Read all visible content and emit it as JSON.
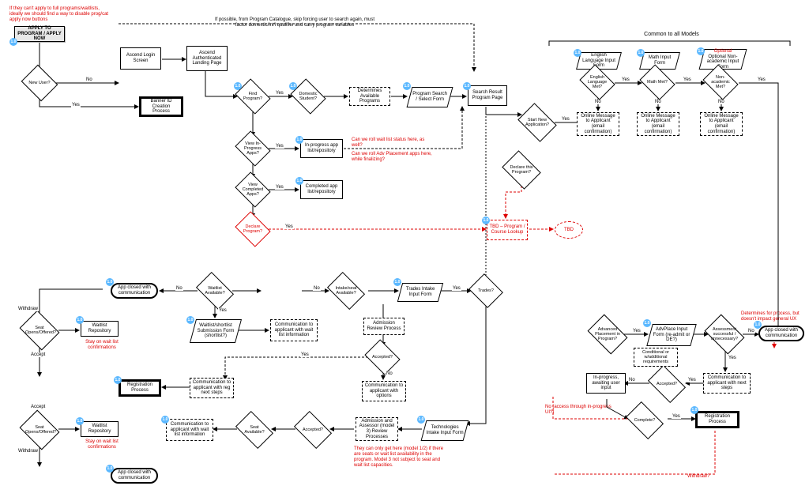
{
  "notes": {
    "top_left": "If they can't apply to full programs/waitlists, ideally we should find a way to disable prog/cat apply now buttons",
    "top_mid": "If possible, from Program Catalogue, skip forcing user to search again, must factor domestic/int'l qualifier and carry program variables",
    "common": "Common to all Models",
    "inprog_q1": "Can we roll wait list status here, as well?",
    "inprog_q2": "Can we roll Adv Placement apps here, while finalizing?",
    "stay1": "Stay on wait list confirmations",
    "stay2": "Stay on wait list confirmations",
    "model_note": "They can only get here (model 1/2) if there are seats or wait list availability in the program. Model 3 not subject to seat and wait list capacities.",
    "no_access": "No (access through in-progress UI?)",
    "withdraw_q": "Withdraw?",
    "det_process": "Determines for process, but doesn't impact general UX"
  },
  "start": "APPLY TO PROGRAM / APPLY NOW",
  "nodes": {
    "new_user": "New User?",
    "ascend_login": "Ascend Login Screen",
    "ascend_landing": "Ascend Authenticated Landing Page",
    "banner_id": "Banner ID Creation Process",
    "find_program": "Find Program?",
    "domestic": "Domestic Student?",
    "det_programs": "Determines Available Programs",
    "search_form": "Program Search / Select Form",
    "search_result": "Search Result Program Page",
    "view_inprog": "View In-Progress Apps?",
    "inprog_list": "In-progress app list/repository",
    "view_complete": "View Completed Apps?",
    "complete_list": "Completed app list/repository",
    "declare": "Declare Program?",
    "tbd_lookup": "TBD – Program / Course Lookup",
    "tbd": "TBD",
    "start_new": "Start New Application?",
    "eng_form": "English Language Input Form",
    "eng_met": "English Language Met?",
    "math_form": "Math Input Form",
    "math_met": "Math Met?",
    "nonacad_form": "Optional Non-academic Input Form",
    "nonacad_met": "Non-academic Met?",
    "msg_eng": "Online Message to Applicant (email confirmation)",
    "msg_math": "Online Message to Applicant (email confirmation)",
    "msg_nonacad": "Online Message to Applicant (email confirmation)",
    "declare_this": "Declare this Program?",
    "advplace": "Advanced Placement in Program?",
    "advplace_form": "AdvPlace Input Form (re-admit or DE?)",
    "assess": "Assessment successful / unnecessary?",
    "app_closed_r": "App closed with communication",
    "inprog_wait": "In-progress, awaiting user input",
    "cond_req": "Conditional or w/additional requirements",
    "accepted_r": "Accepted?",
    "comm_next_r": "Communication to applicant with next steps",
    "complete_q": "Complete?",
    "reg_process_r": "Registration Process",
    "trades_q": "Trades?",
    "trades_form": "Trades Intake Input Form",
    "intake_avail": "Intake/seat Available?",
    "waitlist_avail": "Waitlist Available?",
    "app_closed_l1": "App closed with communication",
    "waitlist_form": "Waitlist/shortlist Submission Form (shortlist?)",
    "comm_wait": "Communication to applicant with wait list information",
    "adm_review": "Admission Review Process",
    "accepted_m": "Accepted?",
    "comm_options": "Communication to applicant with options",
    "tech_form": "Technologies Intake Input Form",
    "adm_assessor": "Admission and Assessor (model 3) Review Processes",
    "accepted_b": "Accepted?",
    "seat_avail": "Seat Available?",
    "comm_wait2": "Communication to applicant with wait list information",
    "waitlist_repo1": "Waitlist Repository",
    "waitlist_repo2": "Waitlist Repository",
    "seat_open1": "Seat Opens/Offered?",
    "seat_open2": "Seat Opens/Offered?",
    "reg_process_l": "Registration Process",
    "comm_reg_next": "Communication to applicant with reg next steps",
    "app_closed_l2": "App closed with communication"
  },
  "labels": {
    "yes": "Yes",
    "no": "No",
    "withdraw": "Withdraw",
    "accept": "Accept"
  },
  "tags": {
    "generic": "1.0"
  }
}
